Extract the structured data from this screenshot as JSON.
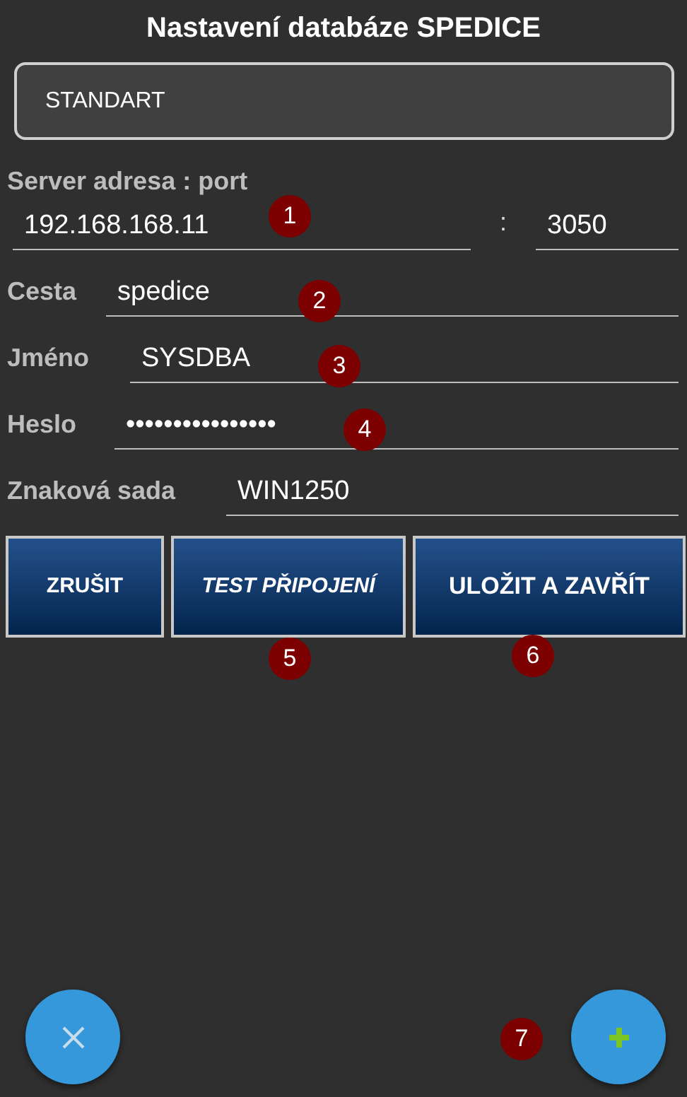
{
  "title": "Nastavení databáze SPEDICE",
  "profile": {
    "value": "STANDART"
  },
  "server": {
    "label": "Server adresa : port",
    "address": "192.168.168.11",
    "separator": ":",
    "port": "3050",
    "marker": "1"
  },
  "fields": [
    {
      "label": "Cesta",
      "value": "spedice",
      "marker": "2"
    },
    {
      "label": "Jméno",
      "value": "SYSDBA",
      "marker": "3"
    },
    {
      "label": "Heslo",
      "value": "••••••••••••••••",
      "marker": "4"
    },
    {
      "label": "Znaková sada",
      "value": "WIN1250"
    }
  ],
  "buttons": [
    {
      "label": "ZRUŠIT"
    },
    {
      "label": "TEST PŘIPOJENÍ",
      "marker": "5"
    },
    {
      "label": "ULOŽIT A ZAVŘÍT",
      "marker": "6"
    }
  ],
  "fabs": [
    {
      "kind": "close"
    },
    {
      "kind": "add",
      "marker": "7"
    }
  ]
}
